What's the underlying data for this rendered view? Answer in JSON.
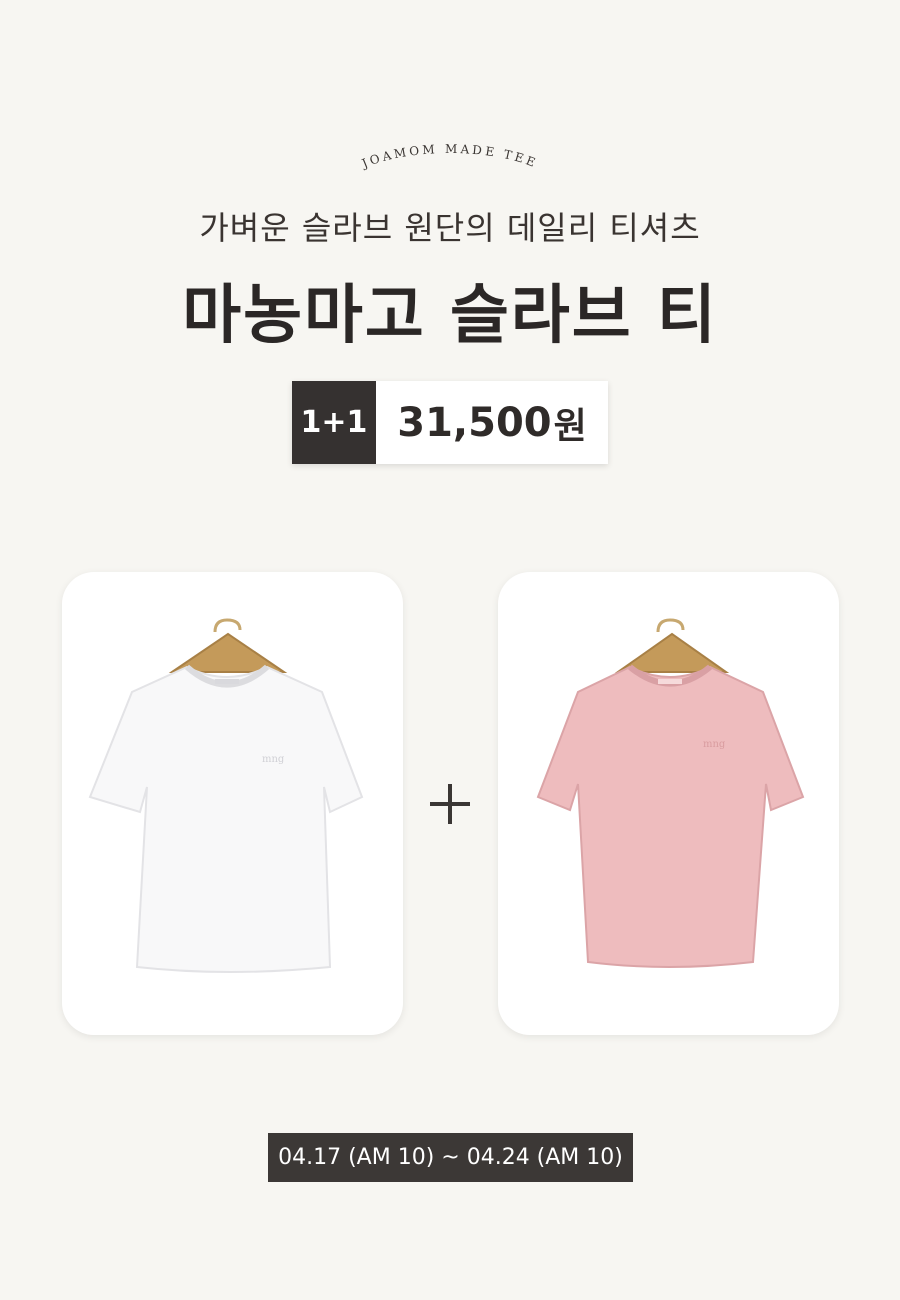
{
  "brand_arc": "JOAMOM MADE TEE",
  "subtitle": "가벼운 슬라브 원단의 데일리 티셔츠",
  "title": "마농마고 슬라브 티",
  "price": {
    "badge": "1+1",
    "amount": "31,500",
    "unit": "원"
  },
  "products": [
    {
      "color_name": "white",
      "color": "#f8f8f9"
    },
    {
      "color_name": "pink",
      "color": "#eebcbe"
    }
  ],
  "date_range": "04.17 (AM 10) ~ 04.24 (AM 10)",
  "colors": {
    "background": "#f7f6f2",
    "dark": "#353130",
    "hanger": "#c49a5a"
  }
}
